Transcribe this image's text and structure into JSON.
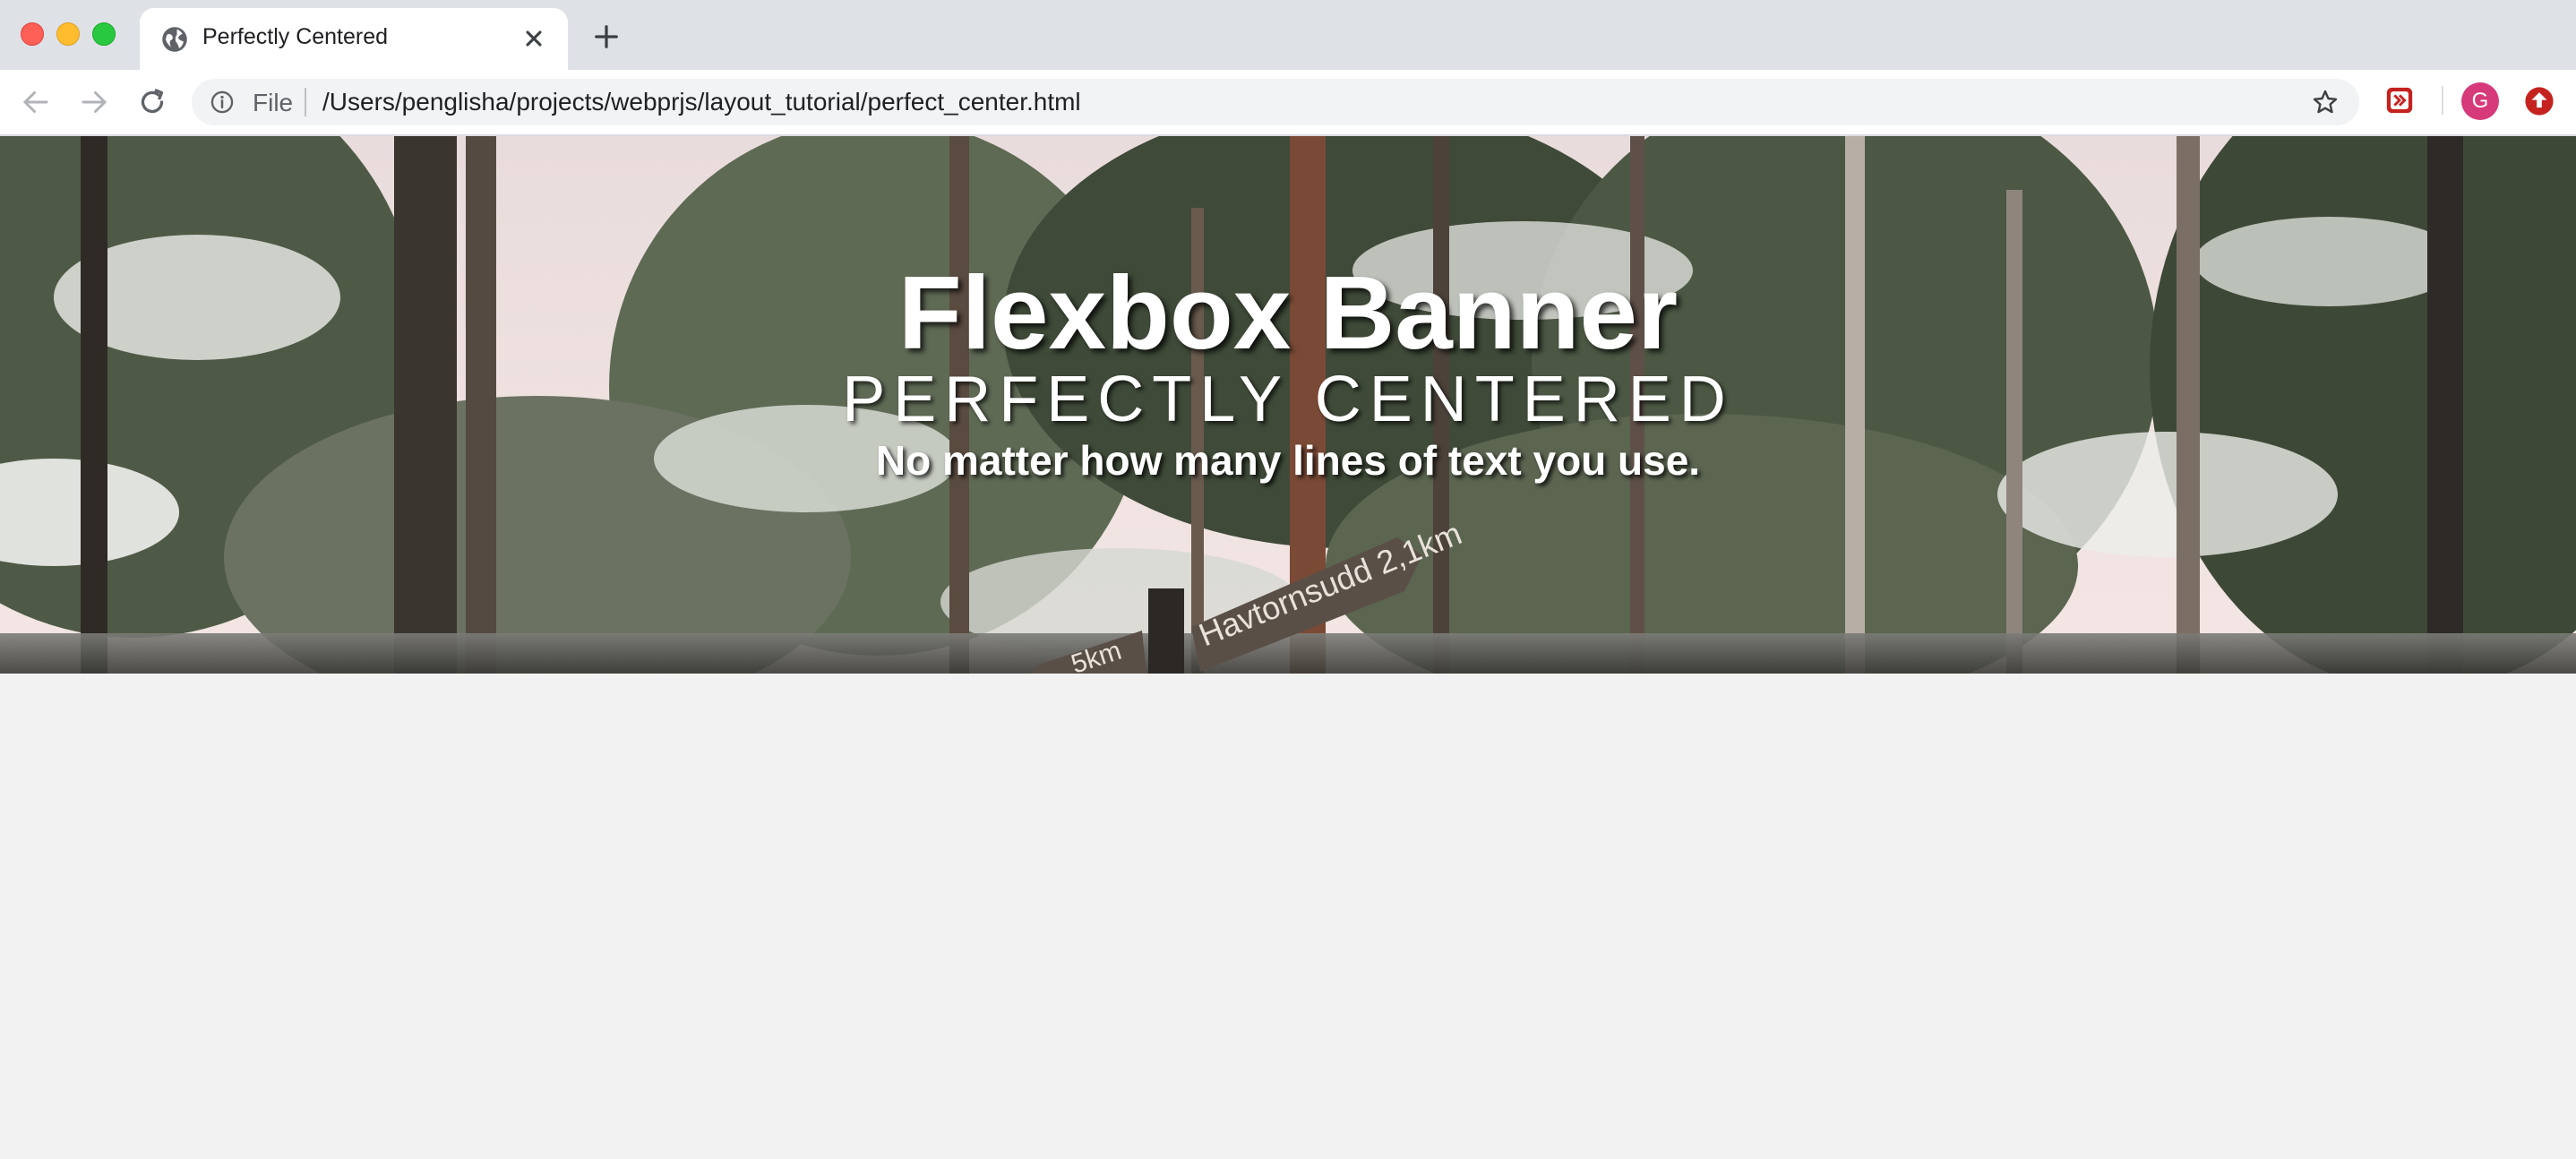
{
  "browser": {
    "tab": {
      "title": "Perfectly Centered",
      "favicon": "globe-icon"
    },
    "address_bar": {
      "scheme_label": "File",
      "url": "/Users/penglisha/projects/webprjs/layout_tutorial/perfect_center.html"
    },
    "profile": {
      "initial": "G",
      "color": "#d63a7a"
    }
  },
  "banner": {
    "title": "Flexbox Banner",
    "subtitle": "PERFECTLY CENTERED",
    "tagline": "No matter how many lines of text you use.",
    "background": "snowy-forest-photo",
    "signpost_text": "Havtornsudd 2,1km",
    "signpost_text_left": "5km"
  },
  "colors": {
    "tabbar": "#dee1e6",
    "page_background": "#f2f2f2",
    "text": "#ffffff"
  }
}
